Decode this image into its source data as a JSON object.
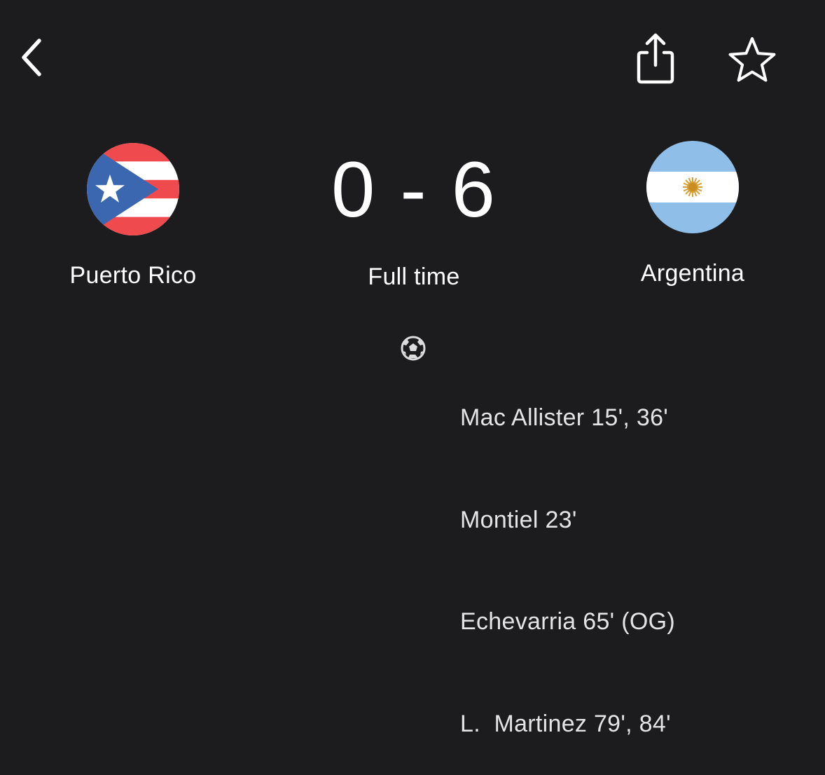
{
  "header": {
    "back_icon": "chevron-left-icon",
    "share_icon": "share-icon",
    "favorite_icon": "star-outline-icon"
  },
  "match": {
    "home": {
      "name": "Puerto Rico",
      "flag": "puerto-rico-flag"
    },
    "away": {
      "name": "Argentina",
      "flag": "argentina-flag"
    },
    "score": {
      "home": "0",
      "separator": "-",
      "away": "6"
    },
    "status": "Full time"
  },
  "goals": {
    "icon": "soccer-ball-icon",
    "scorers": [
      "Mac Allister 15', 36'",
      "Montiel 23'",
      "Echevarria 65' (OG)",
      "L.  Martinez 79', 84'"
    ]
  },
  "colors": {
    "background": "#1c1c1e",
    "text": "#ffffff",
    "scorer_text": "#e4e4e6",
    "pr_red": "#ef4b4f",
    "pr_blue": "#3b67b0",
    "ar_sky": "#8fbfe8",
    "ar_sun": "#d7a13a"
  }
}
